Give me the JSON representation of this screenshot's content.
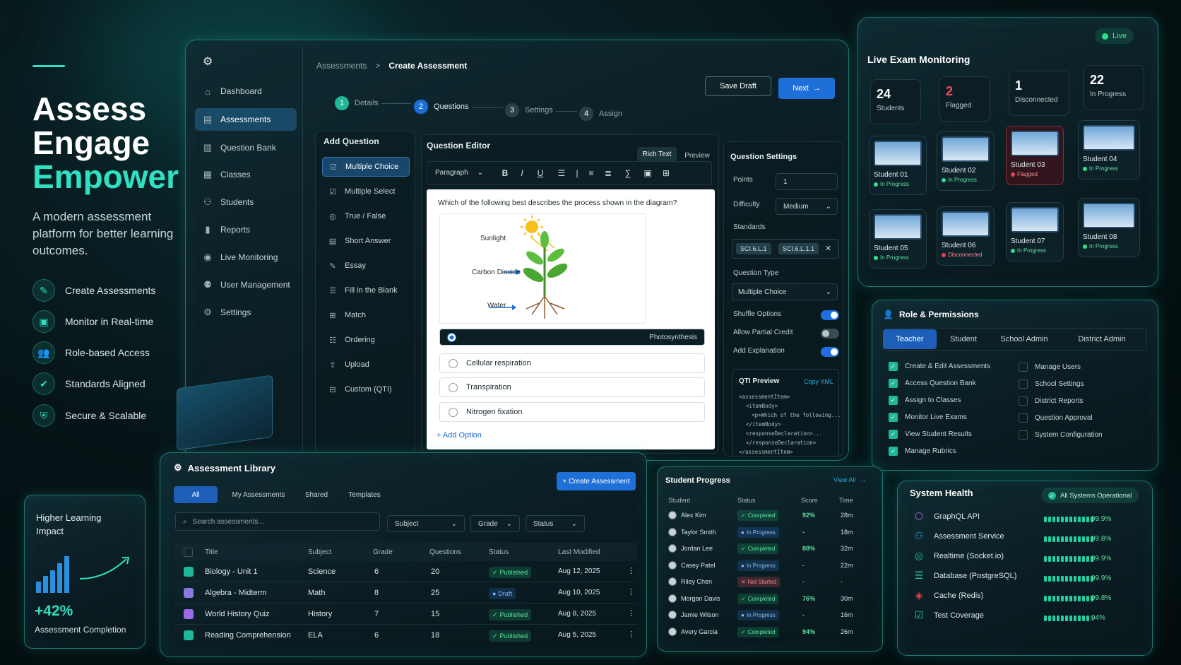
{
  "hero": {
    "title_line1": "Assess",
    "title_line2": "Engage",
    "title_line3": "Empower",
    "subtitle": "A modern assessment platform for better learning outcomes.",
    "features": [
      "Create Assessments",
      "Monitor in Real-time",
      "Role-based Access",
      "Standards Aligned",
      "Secure & Scalable"
    ]
  },
  "impact": {
    "title": "Higher Learning Impact",
    "value": "+42%",
    "label": "Assessment Completion"
  },
  "sidebar": {
    "items": [
      {
        "label": "Dashboard",
        "icon": "home-icon"
      },
      {
        "label": "Assessments",
        "icon": "clipboard-icon",
        "active": true
      },
      {
        "label": "Question Bank",
        "icon": "book-icon"
      },
      {
        "label": "Classes",
        "icon": "classes-icon"
      },
      {
        "label": "Students",
        "icon": "users-icon"
      },
      {
        "label": "Reports",
        "icon": "chart-icon"
      },
      {
        "label": "Live Monitoring",
        "icon": "monitor-icon"
      },
      {
        "label": "User Management",
        "icon": "user-cog-icon"
      },
      {
        "label": "Settings",
        "icon": "gear-icon"
      }
    ]
  },
  "breadcrumb": {
    "parent": "Assessments",
    "separator": ">",
    "current": "Create Assessment"
  },
  "actions": {
    "save_draft": "Save Draft",
    "next": "Next"
  },
  "steps": [
    {
      "num": "1",
      "label": "Details"
    },
    {
      "num": "2",
      "label": "Questions"
    },
    {
      "num": "3",
      "label": "Settings"
    },
    {
      "num": "4",
      "label": "Assign"
    }
  ],
  "add_question": {
    "title": "Add Question",
    "types": [
      "Multiple Choice",
      "Multiple Select",
      "True / False",
      "Short Answer",
      "Essay",
      "Fill in the Blank",
      "Match",
      "Ordering",
      "Upload",
      "Custom (QTI)"
    ]
  },
  "editor": {
    "title": "Question Editor",
    "tab_rich": "Rich Text",
    "tab_preview": "Preview",
    "format": "Paragraph",
    "question": "Which of the following best describes the process shown in the diagram?",
    "diagram": {
      "sunlight": "Sunlight",
      "co2": "Carbon Dioxide",
      "water": "Water"
    },
    "options": [
      "Photosynthesis",
      "Cellular respiration",
      "Transpiration",
      "Nitrogen fixation"
    ],
    "add_option": "+ Add Option"
  },
  "settings": {
    "title": "Question Settings",
    "points_label": "Points",
    "points_value": "1",
    "difficulty_label": "Difficulty",
    "difficulty_value": "Medium",
    "standards_label": "Standards",
    "standard1": "SCI.6.L.1",
    "standard2": "SCI.6.L.1.1",
    "qtype_label": "Question Type",
    "qtype_value": "Multiple Choice",
    "shuffle": "Shuffle Options",
    "partial": "Allow Partial Credit",
    "explanation": "Add Explanation",
    "qti_title": "QTI Preview",
    "copy_xml": "Copy XML",
    "qti_lines": [
      "<assessmentItem>",
      "<itemBody>",
      "<p>Which of the following...",
      "</itemBody>",
      "<responseDeclaration>...",
      "</responseDeclaration>",
      "</assessmentItem>"
    ]
  },
  "live": {
    "title": "Live Exam Monitoring",
    "status": "Live",
    "stats": [
      {
        "n": "24",
        "l": "Students"
      },
      {
        "n": "2",
        "l": "Flagged"
      },
      {
        "n": "1",
        "l": "Disconnected"
      },
      {
        "n": "22",
        "l": "In Progress"
      }
    ],
    "students": [
      {
        "name": "Student 01",
        "status": "In Progress"
      },
      {
        "name": "Student 02",
        "status": "In Progress"
      },
      {
        "name": "Student 03",
        "status": "Flagged"
      },
      {
        "name": "Student 04",
        "status": "In Progress"
      },
      {
        "name": "Student 05",
        "status": "In Progress"
      },
      {
        "name": "Student 06",
        "status": "Disconnected"
      },
      {
        "name": "Student 07",
        "status": "In Progress"
      },
      {
        "name": "Student 08",
        "status": "In Progress"
      }
    ]
  },
  "roles": {
    "title": "Role & Permissions",
    "tabs": [
      "Teacher",
      "Student",
      "School Admin",
      "District Admin"
    ],
    "granted": [
      "Create & Edit Assessments",
      "Access Question Bank",
      "Assign to Classes",
      "Monitor Live Exams",
      "View Student Results",
      "Manage Rubrics"
    ],
    "denied": [
      "Manage Users",
      "School Settings",
      "District Reports",
      "Question Approval",
      "System Configuration"
    ]
  },
  "library": {
    "title": "Assessment Library",
    "create": "+ Create Assessment",
    "tabs": [
      "All",
      "My Assessments",
      "Shared",
      "Templates"
    ],
    "search_placeholder": "Search assessments...",
    "filters": [
      "Subject",
      "Grade",
      "Status"
    ],
    "columns": [
      "Title",
      "Subject",
      "Grade",
      "Questions",
      "Status",
      "Last Modified"
    ],
    "rows": [
      {
        "title": "Biology - Unit 1",
        "subject": "Science",
        "grade": "6",
        "questions": "20",
        "status": "Published",
        "modified": "Aug 12, 2025"
      },
      {
        "title": "Algebra - Midterm",
        "subject": "Math",
        "grade": "8",
        "questions": "25",
        "status": "Draft",
        "modified": "Aug 10, 2025"
      },
      {
        "title": "World History Quiz",
        "subject": "History",
        "grade": "7",
        "questions": "15",
        "status": "Published",
        "modified": "Aug 8, 2025"
      },
      {
        "title": "Reading Comprehension",
        "subject": "ELA",
        "grade": "6",
        "questions": "18",
        "status": "Published",
        "modified": "Aug 5, 2025"
      }
    ]
  },
  "progress": {
    "title": "Student Progress",
    "view_all": "View All",
    "columns": [
      "Student",
      "Status",
      "Score",
      "Time"
    ],
    "rows": [
      {
        "name": "Alex Kim",
        "status": "Completed",
        "score": "92%",
        "time": "28m"
      },
      {
        "name": "Taylor Smith",
        "status": "In Progress",
        "score": "-",
        "time": "18m"
      },
      {
        "name": "Jordan Lee",
        "status": "Completed",
        "score": "88%",
        "time": "32m"
      },
      {
        "name": "Casey Patel",
        "status": "In Progress",
        "score": "-",
        "time": "22m"
      },
      {
        "name": "Riley Chen",
        "status": "Not Started",
        "score": "-",
        "time": "-"
      },
      {
        "name": "Morgan Davis",
        "status": "Completed",
        "score": "76%",
        "time": "30m"
      },
      {
        "name": "Jamie Wilson",
        "status": "In Progress",
        "score": "-",
        "time": "16m"
      },
      {
        "name": "Avery Garcia",
        "status": "Completed",
        "score": "94%",
        "time": "26m"
      }
    ]
  },
  "health": {
    "title": "System Health",
    "status": "All Systems Operational",
    "items": [
      {
        "name": "GraphQL API",
        "pct": "99.9%"
      },
      {
        "name": "Assessment Service",
        "pct": "99.8%"
      },
      {
        "name": "Realtime (Socket.io)",
        "pct": "99.9%"
      },
      {
        "name": "Database (PostgreSQL)",
        "pct": "99.9%"
      },
      {
        "name": "Cache (Redis)",
        "pct": "99.8%"
      },
      {
        "name": "Test Coverage",
        "pct": "94%"
      }
    ]
  },
  "colors": {
    "accent": "#2fe0c2",
    "primary": "#1e6fd8",
    "success": "#1fb89a",
    "danger": "#e0444f",
    "background": "#061417"
  }
}
